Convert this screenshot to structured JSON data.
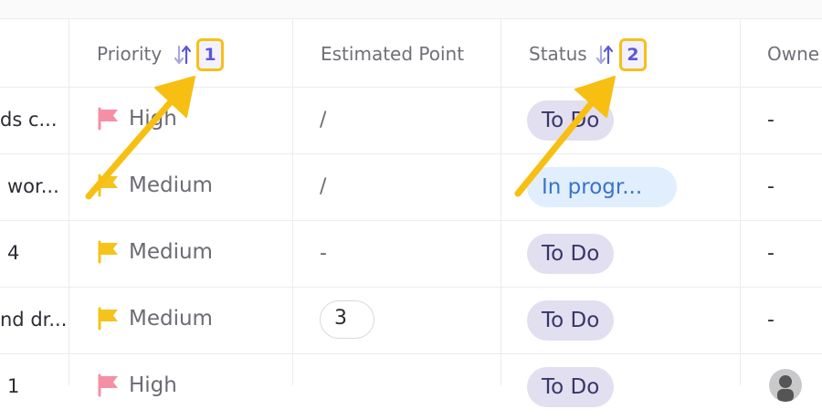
{
  "header": {
    "priority_label": "Priority",
    "priority_sort_badge": "1",
    "estimated_label": "Estimated Point",
    "status_label": "Status",
    "status_sort_badge": "2",
    "owner_label": "Owne"
  },
  "rows": [
    {
      "name": "ds c...",
      "priority": "High",
      "priority_color": "#f48fa6",
      "estimate": "/",
      "status": "To Do",
      "owner": "-"
    },
    {
      "name": "wor...",
      "priority": "Medium",
      "priority_color": "#f5c31b",
      "estimate": "/",
      "status": "In progr...",
      "owner": "-"
    },
    {
      "name": "4",
      "priority": "Medium",
      "priority_color": "#f5c31b",
      "estimate": "-",
      "status": "To Do",
      "owner": "-"
    },
    {
      "name": "nd dr...",
      "priority": "Medium",
      "priority_color": "#f5c31b",
      "estimate": "3",
      "status": "To Do",
      "owner": "-"
    },
    {
      "name": "1",
      "priority": "High",
      "priority_color": "#f48fa6",
      "estimate": "",
      "status": "To Do",
      "owner": ""
    }
  ],
  "colors": {
    "accent": "#5a58d8",
    "highlight": "#f5c019",
    "status_todo_bg": "#e2dff0",
    "status_progress_bg": "#e0eefe",
    "status_progress_text": "#3b73c6"
  }
}
